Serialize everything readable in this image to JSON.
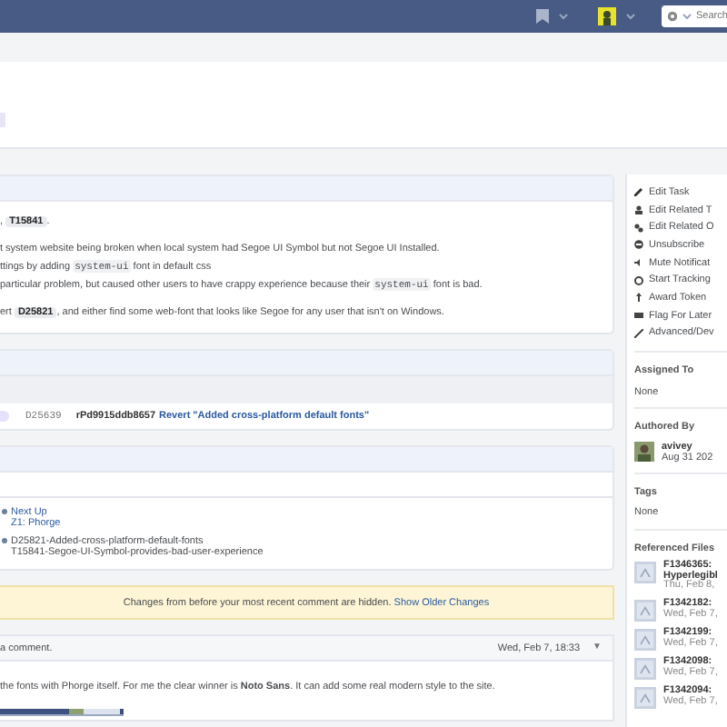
{
  "navbar": {
    "search": {
      "placeholder": "Search"
    }
  },
  "description": {
    "lines": [
      {
        "parts": [
          {
            "text": ", "
          },
          {
            "ref": "T15841"
          },
          {
            "text": "."
          }
        ]
      },
      {
        "parts": [
          {
            "text": "t system website being broken when local system had Segoe UI Symbol but not Segoe UI Installed."
          }
        ]
      },
      {
        "parts": [
          {
            "text": "ttings by adding "
          },
          {
            "code": "system-ui"
          },
          {
            "text": " font in default css"
          }
        ]
      },
      {
        "parts": [
          {
            "text": " particular problem, but caused other users to have crappy experience because their "
          },
          {
            "code": "system-ui"
          },
          {
            "text": " font is bad."
          }
        ]
      },
      {
        "parts": [
          {
            "text": "ert "
          },
          {
            "ref": "D25821"
          },
          {
            "text": ", and either find some web-font that looks like Segoe for any user that isn't on Windows."
          }
        ]
      }
    ]
  },
  "commits": [
    {
      "revision": "D25639",
      "hash": "rPd9915ddb8657",
      "message": "Revert \"Added cross-platform default fonts\""
    }
  ],
  "board": {
    "column": "Next Up",
    "project": "Z1: Phorge"
  },
  "branches": [
    "D25821-Added-cross-platform-default-fonts",
    "T15841-Segoe-UI-Symbol-provides-bad-user-experience"
  ],
  "notice": {
    "text": "Changes from before your most recent comment are hidden.",
    "link": "Show Older Changes"
  },
  "comment": {
    "header": "a comment.",
    "date": "Wed, Feb 7, 18:33",
    "menu": "▼",
    "body": "the fonts with Phorge itself. For me the clear winner is **Noto Sans**. It can add some real modern style to the site."
  },
  "actions": [
    "Edit Task",
    "Edit Related T",
    "Edit Related O",
    "Unsubscribe",
    "Mute Notificat",
    "Start Tracking",
    "Award Token",
    "Flag For Later",
    "Advanced/Dev"
  ],
  "assigned_to": {
    "label": "Assigned To",
    "value": "None"
  },
  "authored_by": {
    "label": "Authored By",
    "user": "avivey",
    "date": "Aug 31 202"
  },
  "tags": {
    "label": "Tags",
    "value": "None"
  },
  "referenced_files": {
    "label": "Referenced Files",
    "files": [
      {
        "name": "F1346365:",
        "detail": "Hyperlegibl",
        "date": "Thu, Feb 8,"
      },
      {
        "name": "F1342182:",
        "date": "Wed, Feb 7,"
      },
      {
        "name": "F1342199:",
        "date": "Wed, Feb 7,"
      },
      {
        "name": "F1342098:",
        "date": "Wed, Feb 7,"
      },
      {
        "name": "F1342094:",
        "date": "Wed, Feb 7,"
      }
    ]
  }
}
